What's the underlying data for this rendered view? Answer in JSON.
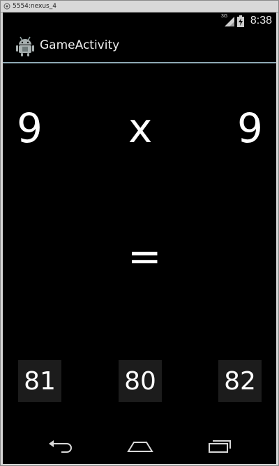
{
  "window": {
    "title": "5554:nexus_4"
  },
  "status_bar": {
    "network": "3G",
    "time": "8:38",
    "icons": [
      "signal-icon",
      "battery-icon"
    ]
  },
  "action_bar": {
    "title": "GameActivity",
    "icon": "android-icon"
  },
  "question": {
    "left_operand": "9",
    "operator": "x",
    "right_operand": "9",
    "equals": "="
  },
  "answers": [
    "81",
    "80",
    "82"
  ],
  "nav_bar": {
    "icons": [
      "back-icon",
      "home-icon",
      "recent-apps-icon"
    ]
  },
  "colors": {
    "background": "#000000",
    "divider": "#8ea8b4",
    "button": "#1c1c1c",
    "text": "#ffffff"
  }
}
